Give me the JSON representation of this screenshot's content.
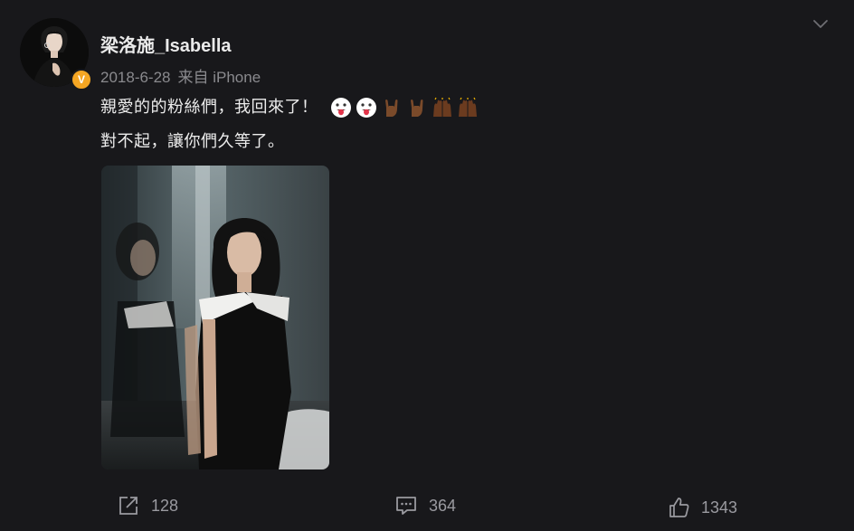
{
  "post": {
    "username": "梁洛施_Isabella",
    "date": "2018-6-28",
    "source": "来自 iPhone",
    "line1": "親愛的的粉絲們，我回來了！",
    "line2": "對不起，讓你們久等了。",
    "verified_label": "V",
    "emojis": [
      "tongue-out-emoji",
      "tongue-out-emoji",
      "rock-hand-emoji",
      "rock-hand-emoji",
      "raised-hands-emoji",
      "raised-hands-emoji"
    ]
  },
  "actions": {
    "repost_count": "128",
    "comment_count": "364",
    "like_count": "1343"
  },
  "colors": {
    "background": "#18181b",
    "primary_text": "#ececec",
    "secondary_text": "#8a8a8e",
    "verified_badge": "#f5a623"
  }
}
